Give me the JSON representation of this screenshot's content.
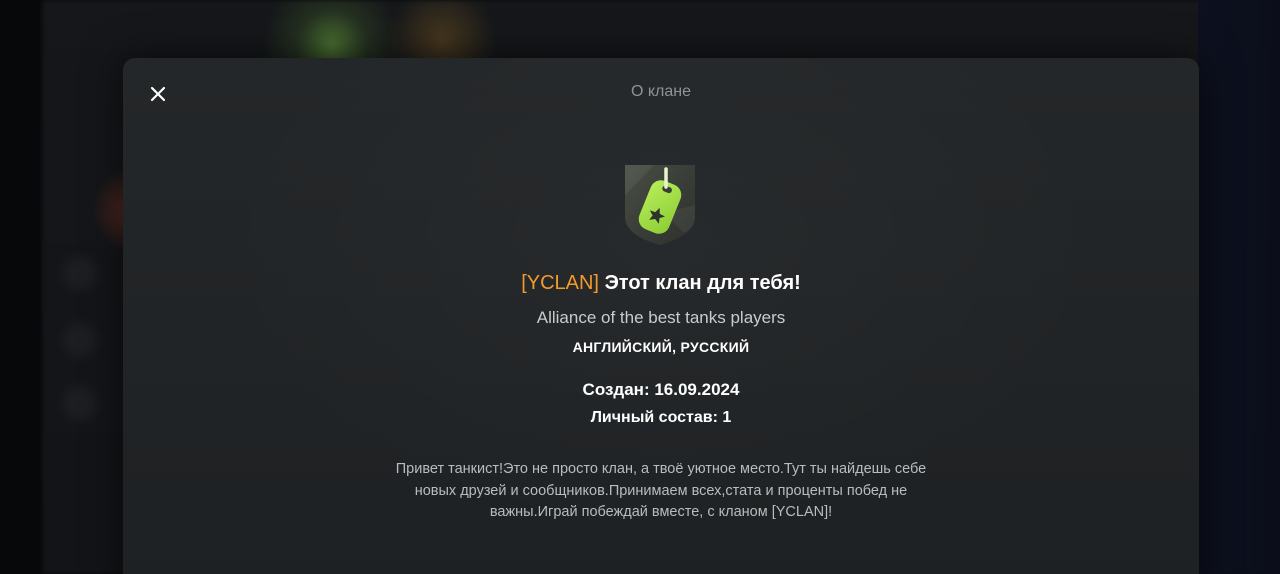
{
  "modal": {
    "title": "О клане",
    "close_icon": "close-icon"
  },
  "clan": {
    "emblem_icon": "dog-tag-star-icon",
    "tag": "[YCLAN]",
    "name": "Этот клан для тебя!",
    "motto": "Alliance of the best tanks players",
    "languages": "АНГЛИЙСКИЙ, РУССКИЙ",
    "created_label": "Создан:",
    "created_value": "16.09.2024",
    "members_label": "Личный состав:",
    "members_value": "1",
    "description": "Привет танкист!Это не просто клан, а твоё уютное место.Тут ты найдешь себе новых друзей и сообщников.Принимаем всех,стата и проценты побед не важны.Играй побеждай вместе, с кланом [YCLAN]!"
  },
  "colors": {
    "accent_tag": "#f39a2c",
    "emblem_green": "#a6e14d",
    "modal_bg": "#222527"
  }
}
